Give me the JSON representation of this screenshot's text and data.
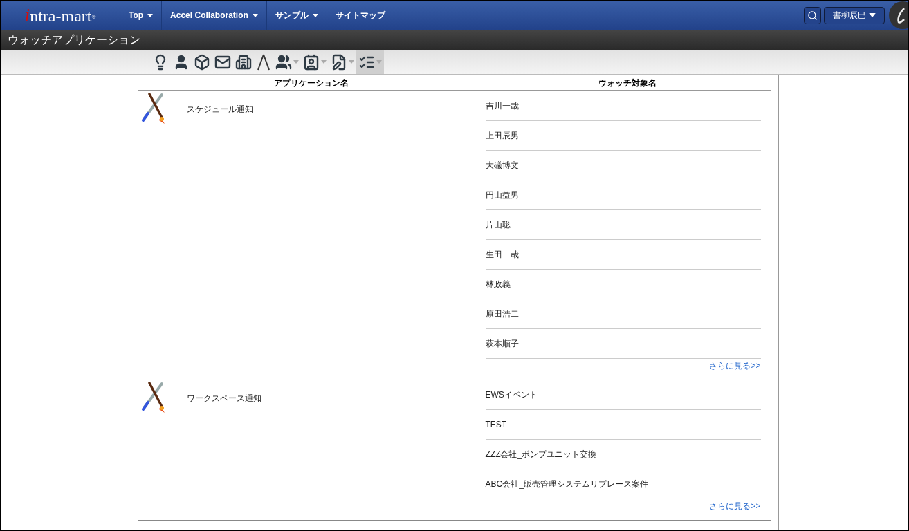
{
  "header": {
    "logo": {
      "text": "intra-mart",
      "mark": "®"
    },
    "nav": [
      {
        "label": "Top",
        "has_menu": true
      },
      {
        "label": "Accel Collaboration",
        "has_menu": true
      },
      {
        "label": "サンプル",
        "has_menu": true
      },
      {
        "label": "サイトマップ",
        "has_menu": false
      }
    ],
    "user": "書柳辰巳"
  },
  "page_title": "ウォッチアプリケーション",
  "toolbar": [
    {
      "kind": "bulb",
      "dropdown": false,
      "selected": false
    },
    {
      "kind": "person",
      "dropdown": false,
      "selected": false
    },
    {
      "kind": "box",
      "dropdown": false,
      "selected": false
    },
    {
      "kind": "mail",
      "dropdown": false,
      "selected": false
    },
    {
      "kind": "building",
      "dropdown": false,
      "selected": false
    },
    {
      "kind": "compass",
      "dropdown": false,
      "selected": false
    },
    {
      "kind": "people",
      "dropdown": true,
      "selected": false
    },
    {
      "kind": "portrait",
      "dropdown": true,
      "selected": false
    },
    {
      "kind": "document",
      "dropdown": true,
      "selected": false
    },
    {
      "kind": "checklist",
      "dropdown": true,
      "selected": true
    }
  ],
  "table": {
    "columns": [
      "アプリケーション名",
      "ウォッチ対象名"
    ],
    "rows": [
      {
        "app": "スケジュール通知",
        "targets": [
          "吉川一哉",
          "上田辰男",
          "大礒博文",
          "円山益男",
          "片山聡",
          "生田一哉",
          "林政義",
          "原田浩二",
          "萩本順子"
        ],
        "more": "さらに見る>>"
      },
      {
        "app": "ワークスペース通知",
        "targets": [
          "EWSイベント",
          "TEST",
          "ZZZ会社_ポンプユニット交換",
          "ABC会社_販売管理システムリプレース案件"
        ],
        "more": "さらに見る>>"
      }
    ]
  }
}
